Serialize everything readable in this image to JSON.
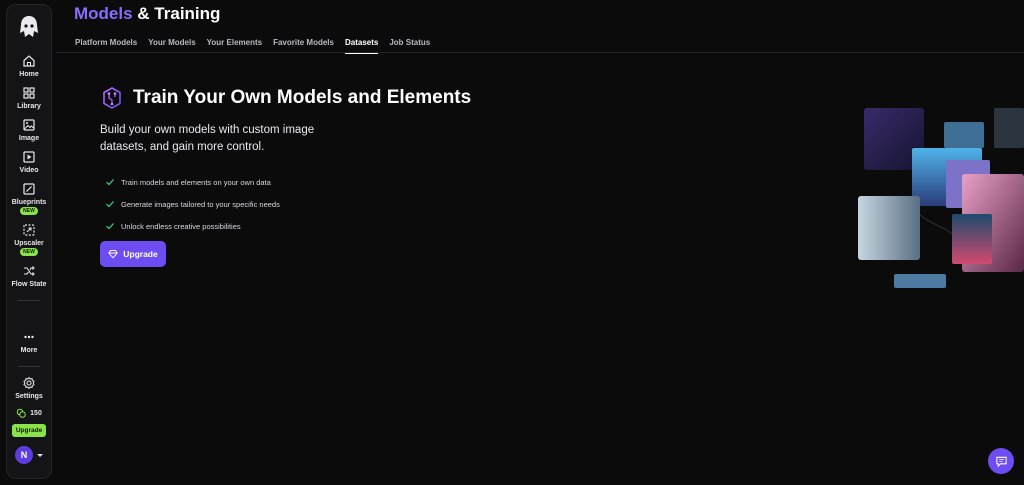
{
  "header": {
    "title_accent": "Models",
    "title_rest": "& Training",
    "tabs": [
      {
        "label": "Platform Models"
      },
      {
        "label": "Your Models"
      },
      {
        "label": "Your Elements"
      },
      {
        "label": "Favorite Models"
      },
      {
        "label": "Datasets",
        "active": true
      },
      {
        "label": "Job Status"
      }
    ]
  },
  "sidebar": {
    "items": [
      {
        "label": "Home",
        "icon": "home-icon"
      },
      {
        "label": "Library",
        "icon": "grid-icon"
      },
      {
        "label": "Image",
        "icon": "image-icon"
      },
      {
        "label": "Video",
        "icon": "video-icon"
      },
      {
        "label": "Blueprints",
        "icon": "blueprint-icon",
        "badge": "NEW"
      },
      {
        "label": "Upscaler",
        "icon": "upscale-icon",
        "badge": "NEW"
      },
      {
        "label": "Flow State",
        "icon": "shuffle-icon"
      }
    ],
    "more_label": "More",
    "settings_label": "Settings",
    "credits": "150",
    "upgrade_label": "Upgrade",
    "avatar_initial": "N"
  },
  "hero": {
    "title": "Train Your Own Models and Elements",
    "description": "Build your own models with custom image datasets, and gain more control.",
    "bullets": [
      "Train models and elements on your own data",
      "Generate images tailored to your specific needs",
      "Unlock endless creative possibilities"
    ],
    "cta_label": "Upgrade"
  },
  "colors": {
    "accent": "#8a6cff",
    "button": "#6d4df2",
    "badge": "#8be34a",
    "check": "#3ecf7a"
  }
}
